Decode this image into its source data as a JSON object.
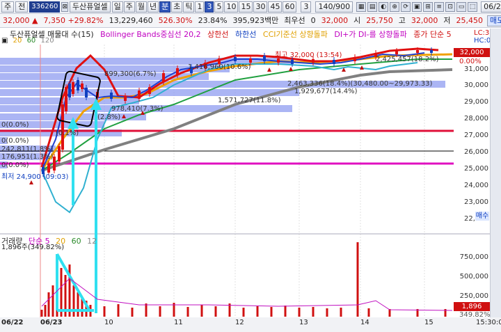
{
  "toolbar1": {
    "c0": "주",
    "c1": "전",
    "code": "336260",
    "ico": "⊠",
    "name": "두산퓨얼셀",
    "periods": [
      "일",
      "주",
      "월",
      "년",
      "분",
      "초",
      "틱",
      "1",
      "3",
      "5",
      "10",
      "15",
      "30",
      "45",
      "60"
    ],
    "selected_period": "분",
    "selected_num": "3",
    "spin": "3",
    "count": "140/900",
    "icons": [
      "▦",
      "▤",
      "◐",
      "⊕",
      "⟳",
      "▣",
      "⊞",
      "≡",
      "⊡",
      "▭",
      "⬚"
    ],
    "date": "06/23"
  },
  "quote": {
    "price": "32,000",
    "arrow": "▲",
    "change": "7,350",
    "pct": "+29.82%",
    "volume": "13,229,460",
    "vol_ratio": "526.30%",
    "turnover": "23.84%",
    "amount": "395,923백만",
    "best_label": "최우선",
    "best_val": "0",
    "p2": "32,000",
    "open_label": "시",
    "open": "25,750",
    "high_label": "고",
    "high": "32,000",
    "low_label": "저",
    "low": "25,450",
    "sell": "매도"
  },
  "legend": {
    "a": "두산퓨얼셀 매물대 수(15)",
    "b": "Bollinger Bands중심선 20,2",
    "c": "상한선",
    "d": "하한선",
    "e": "CCI기준선 상향돌파",
    "f": "DI+가 DI-를 상향돌파",
    "g": "종가 단순 5",
    "h": "LC:31,6",
    "h2": "HC:0,000",
    "m1": "20",
    "m2": "60",
    "m3": "120"
  },
  "yaxis": [
    "31,000",
    "30,000",
    "29,000",
    "28,000",
    "27,000",
    "26,000",
    "25,000",
    "24,000",
    "23,000",
    "22,000"
  ],
  "ytags": {
    "price": "32,000",
    "zero": "0.00%",
    "buy": "매수"
  },
  "vaxis": [
    "750,000",
    "500,000",
    "250,000"
  ],
  "vtags": {
    "a": "1,896",
    "b": "349.82%"
  },
  "xaxis": [
    "06/22",
    "06/23",
    "10",
    "11",
    "12",
    "13",
    "14",
    "15",
    "15:30:0"
  ],
  "annotations": {
    "a1": "899,300(6.7%)",
    "a2": "1,416,960(10.6%)",
    "a3": "최고 32,000 (13:54)",
    "a4": "2,425,457(18.2%)",
    "a5": "2,463,336(18.4%)(30,480.00~29,973.33)",
    "a6": "1,929,677(14.4%)",
    "a7": "1,571,727(11.8%)",
    "a8": "978,410(7.3%)",
    "a9": "(2.8%)",
    "a10": "0(0.0%)",
    "a11": "(0.1%)",
    "a12": "0(0.0%)",
    "a13": "242,811(1.8%)",
    "a14": "176,951(1.3%)",
    "a15": "0(0.0%)",
    "a16": "최저 24,900 (09:03)"
  },
  "volume": {
    "label": "거래량",
    "ma": "단순 5",
    "m2": "20",
    "m3": "60",
    "m4": "12",
    "info": "1,896주(349.82%)"
  }
}
